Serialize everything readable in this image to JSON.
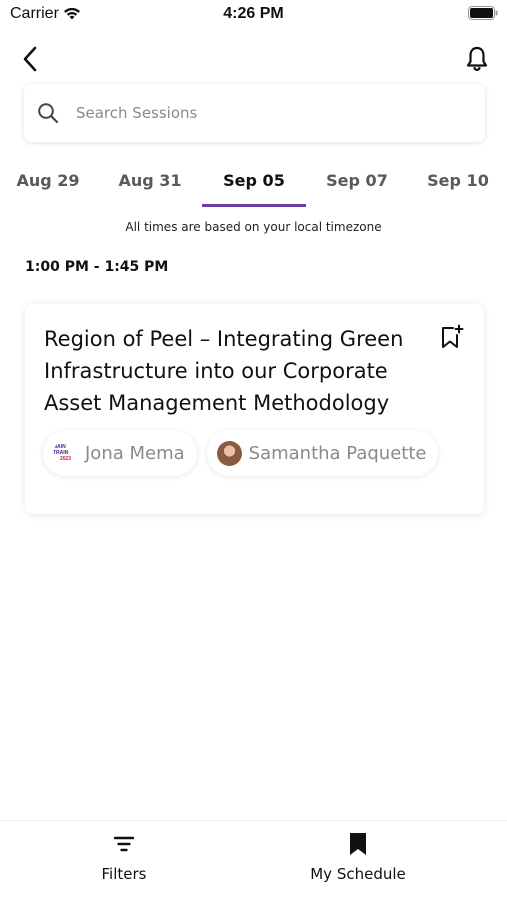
{
  "status_bar": {
    "carrier": "Carrier",
    "time": "4:26 PM"
  },
  "header": {
    "back_icon": "chevron-left-icon",
    "notification_icon": "bell-icon"
  },
  "search": {
    "placeholder": "Search Sessions",
    "value": ""
  },
  "date_tabs": [
    {
      "label": "Aug 29",
      "active": false
    },
    {
      "label": "Aug 31",
      "active": false
    },
    {
      "label": "Sep 05",
      "active": true
    },
    {
      "label": "Sep 07",
      "active": false
    },
    {
      "label": "Sep 10",
      "active": false
    }
  ],
  "timezone_note": "All times are based on your local timezone",
  "time_slot": "1:00 PM - 1:45 PM",
  "session": {
    "title": "Region of Peel – Integrating Green Infrastructure into our Corporate Asset Management Methodology",
    "bookmark_icon": "bookmark-add-icon",
    "speakers": [
      {
        "name": "Jona Mema",
        "avatar": "MAIN TRAIN 2023",
        "avatar_line1": "MAIN TRAIN",
        "avatar_line2": "2023"
      },
      {
        "name": "Samantha Paquette",
        "avatar": "photo"
      }
    ]
  },
  "bottom_nav": {
    "filters_label": "Filters",
    "schedule_label": "My Schedule"
  },
  "colors": {
    "accent": "#6b3fa0",
    "muted_text": "#8a8a8a"
  }
}
